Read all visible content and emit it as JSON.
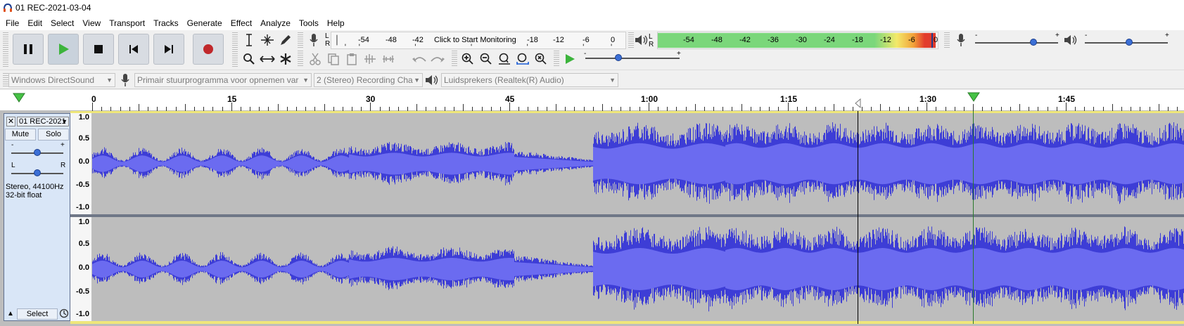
{
  "window": {
    "title": "01 REC-2021-03-04"
  },
  "menu": [
    "File",
    "Edit",
    "Select",
    "View",
    "Transport",
    "Tracks",
    "Generate",
    "Effect",
    "Analyze",
    "Tools",
    "Help"
  ],
  "meters": {
    "record_channels": [
      "L",
      "R"
    ],
    "record_scale": [
      "-54",
      "-48",
      "-42",
      "-18",
      "-12",
      "-6",
      "0"
    ],
    "record_prompt": "Click to Start Monitoring",
    "play_channels": [
      "L",
      "R"
    ],
    "play_scale": [
      "-54",
      "-48",
      "-42",
      "-36",
      "-30",
      "-24",
      "-18",
      "-12",
      "-6",
      "0"
    ]
  },
  "sliders": {
    "rec_min": "-",
    "rec_max": "+",
    "play_min": "-",
    "play_max": "+",
    "speed_min": "-",
    "speed_max": "+"
  },
  "devices": {
    "host": "Windows DirectSound",
    "recording_device": "Primair stuurprogramma voor opnemen var",
    "channels": "2 (Stereo) Recording Cha",
    "playback_device": "Luidsprekers (Realtek(R) Audio)"
  },
  "timeline": {
    "labels": [
      "0",
      "15",
      "30",
      "45",
      "1:00",
      "1:15",
      "1:30",
      "1:45"
    ]
  },
  "track": {
    "name": "01 REC-2021",
    "mute": "Mute",
    "solo": "Solo",
    "gain_min": "-",
    "gain_max": "+",
    "pan_left": "L",
    "pan_right": "R",
    "info_line1": "Stereo, 44100Hz",
    "info_line2": "32-bit float",
    "select": "Select",
    "vruler": [
      "1.0",
      "0.5",
      "0.0",
      "-0.5",
      "-1.0"
    ]
  },
  "colors": {
    "waveform": "#3d3dd6",
    "waveform_rms": "#6b6bf0",
    "track_bg": "#bdbdbd",
    "meter_green": "#7bd77b",
    "play_button": "#3cb43c",
    "record_button": "#c0282b"
  }
}
